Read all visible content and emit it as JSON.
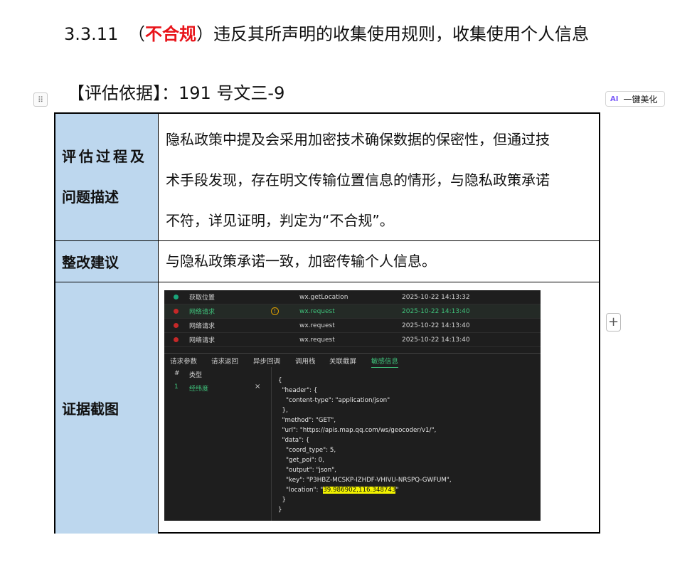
{
  "heading": {
    "number": "3.3.11",
    "open": "（",
    "verdict": "不合规",
    "close": "）",
    "title": "违反其所声明的收集使用规则，收集使用个人信息"
  },
  "basis": {
    "text": "【评估依据】：191 号文三-9"
  },
  "toolbar": {
    "handle_glyph": "⠿",
    "ai_badge": "AI",
    "beautify_label": "一键美化",
    "add_glyph": "+"
  },
  "table": {
    "rows": [
      {
        "label_line1": "评估过程及",
        "label_line2": "问题描述",
        "content_lines": [
          "隐私政策中提及会采用加密技术确保数据的保密性，但通过技",
          "术手段发现，存在明文传输位置信息的情形，与隐私政策承诺",
          "不符，详见证明，判定为“不合规”。"
        ]
      },
      {
        "label": "整改建议",
        "content": "与隐私政策承诺一致，加密传输个人信息。"
      },
      {
        "label": "证据截图"
      }
    ]
  },
  "screenshot": {
    "requests": [
      {
        "name": "获取位置",
        "api": "wx.getLocation",
        "time": "2025-10-22 14:13:32",
        "status_color": "#1aa57a",
        "highlight": false,
        "warn": false
      },
      {
        "name": "网络请求",
        "api": "wx.request",
        "time": "2025-10-22 14:13:40",
        "status_color": "#c62828",
        "highlight": true,
        "warn": true
      },
      {
        "name": "网络请求",
        "api": "wx.request",
        "time": "2025-10-22 14:13:40",
        "status_color": "#c62828",
        "highlight": false,
        "warn": false
      },
      {
        "name": "网络请求",
        "api": "wx.request",
        "time": "2025-10-22 14:13:40",
        "status_color": "#c62828",
        "highlight": false,
        "warn": false
      }
    ],
    "warn_glyph": "!",
    "tabs": [
      "请求参数",
      "请求返回",
      "异步回调",
      "调用栈",
      "关联截屏",
      "敏感信息"
    ],
    "active_tab": "敏感信息",
    "sensitive_table": {
      "col_index": "#",
      "col_type": "类型",
      "row_index": "1",
      "row_type": "经纬度",
      "close_glyph": "×"
    },
    "code_lines": [
      "{",
      "  \"header\": {",
      "    \"content-type\": \"application/json\"",
      "  },",
      "  \"method\": \"GET\",",
      "  \"url\": \"https://apis.map.qq.com/ws/geocoder/v1/\",",
      "  \"data\": {",
      "    \"coord_type\": 5,",
      "    \"get_poi\": 0,",
      "    \"output\": \"json\",",
      "    \"key\": \"P3HBZ-MCSKP-IZHDF-VHIVU-NRSPQ-GWFUM\",",
      "    \"location\": \"",
      "  }",
      "}"
    ],
    "location_value": "39.986902,116.348743",
    "location_suffix": "\"",
    "colors": {
      "green": "#3fc07a",
      "red": "#c62828",
      "teal": "#1aa57a",
      "highlight": "#f2f200"
    }
  }
}
